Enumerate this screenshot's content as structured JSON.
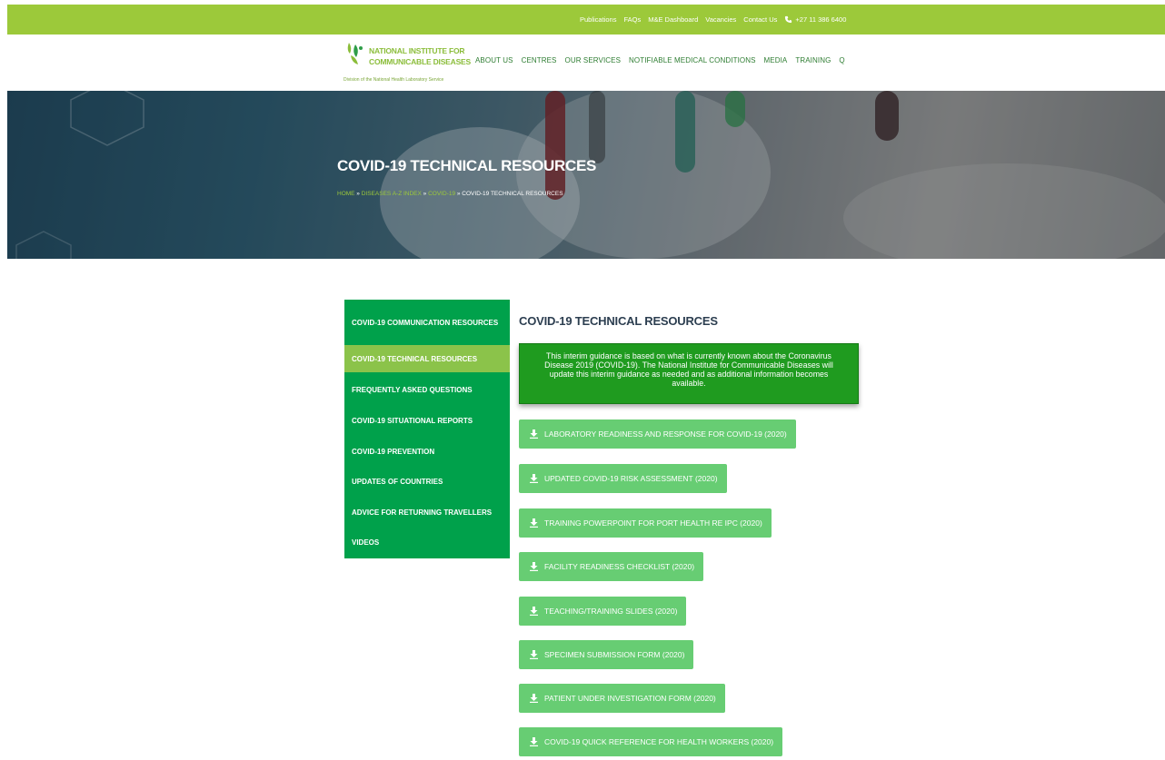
{
  "topbar": {
    "links": [
      "Publications",
      "FAQs",
      "M&E Dashboard",
      "Vacancies",
      "Contact Us"
    ],
    "phone": "+27 11 386 6400"
  },
  "logo": {
    "line1": "NATIONAL INSTITUTE FOR",
    "line2": "COMMUNICABLE DISEASES",
    "sub": "Division of the National Health Laboratory Service"
  },
  "nav": [
    "ABOUT US",
    "CENTRES",
    "OUR SERVICES",
    "NOTIFIABLE MEDICAL CONDITIONS",
    "MEDIA",
    "TRAINING",
    "Q"
  ],
  "hero": {
    "title": "COVID-19 TECHNICAL RESOURCES",
    "breadcrumb": {
      "home": "HOME",
      "sep": " » ",
      "diseases": "DISEASES A-Z INDEX",
      "covid": "COVID-19",
      "current": "COVID-19 TECHNICAL RESOURCES"
    }
  },
  "sidebar": {
    "items": [
      "COVID-19 COMMUNICATION RESOURCES",
      "COVID-19 TECHNICAL RESOURCES",
      "FREQUENTLY ASKED QUESTIONS",
      "COVID-19 SITUATIONAL REPORTS",
      "COVID-19 PREVENTION",
      "UPDATES OF COUNTRIES",
      "ADVICE FOR RETURNING TRAVELLERS",
      "VIDEOS"
    ],
    "active_index": 1
  },
  "content": {
    "title": "COVID-19 TECHNICAL RESOURCES",
    "notice": "This interim guidance is based on what is currently known about the Coronavirus Disease 2019 (COVID-19). The National Institute for Communicable Diseases will update this interim guidance as needed and as additional information becomes available.",
    "downloads": [
      "LABORATORY READINESS AND RESPONSE FOR COVID-19 (2020)",
      "UPDATED COVID-19 RISK ASSESSMENT (2020)",
      "TRAINING POWERPOINT FOR PORT HEALTH RE IPC (2020)",
      "FACILITY READINESS CHECKLIST (2020)",
      "TEACHING/TRAINING SLIDES (2020)",
      "SPECIMEN SUBMISSION FORM (2020)",
      "PATIENT UNDER INVESTIGATION FORM (2020)",
      "COVID-19 QUICK REFERENCE FOR HEALTH WORKERS (2020)"
    ]
  },
  "colors": {
    "topbar": "#9cc93a",
    "sidebar": "#00a14b",
    "sidebar_active": "#8bc34a",
    "notice": "#1f9b1f",
    "button": "#67cd73"
  },
  "icons": {
    "phone": "phone-icon",
    "download": "download-icon",
    "logo": "nicd-logo-icon"
  }
}
